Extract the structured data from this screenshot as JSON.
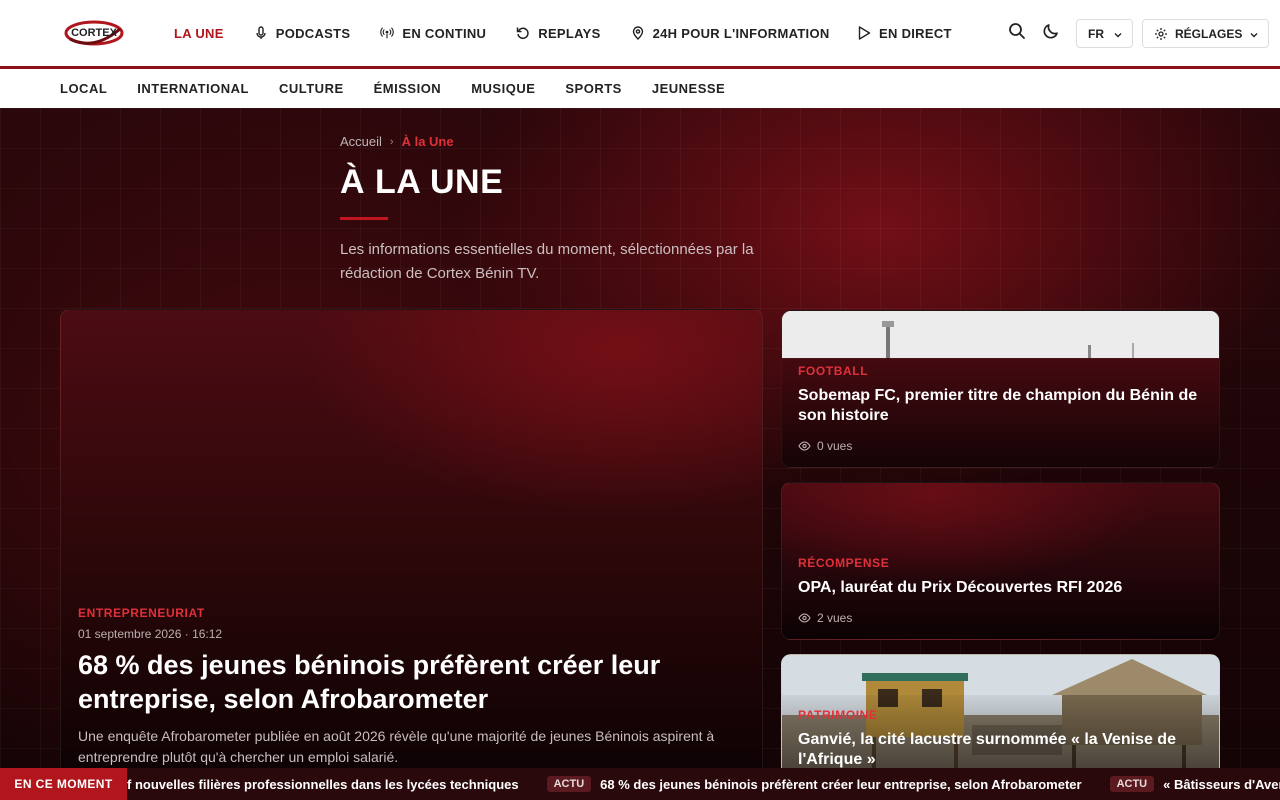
{
  "logo": {
    "text": "CORTEX"
  },
  "nav": {
    "items": [
      {
        "label": "LA UNE",
        "icon": "none"
      },
      {
        "label": "PODCASTS",
        "icon": "microphone-icon"
      },
      {
        "label": "EN CONTINU",
        "icon": "broadcast-icon"
      },
      {
        "label": "REPLAYS",
        "icon": "replay-icon"
      },
      {
        "label": "24H POUR L'INFORMATION",
        "icon": "location-pin-icon"
      }
    ],
    "live_label": "EN DIRECT",
    "language": "FR",
    "settings_label": "RÉGLAGES"
  },
  "subnav": {
    "items": [
      "LOCAL",
      "INTERNATIONAL",
      "CULTURE",
      "ÉMISSION",
      "MUSIQUE",
      "SPORTS",
      "JEUNESSE"
    ]
  },
  "breadcrumb": {
    "home": "Accueil",
    "current": "À la Une"
  },
  "page": {
    "title": "À LA UNE",
    "description": "Les informations essentielles du moment, sélectionnées par la rédaction de Cortex Bénin TV."
  },
  "featured": {
    "category": "ENTREPRENEURIAT",
    "date": "01 septembre 2026 · 16:12",
    "headline": "68 % des jeunes béninois préfèrent créer leur entreprise, selon Afrobarometer",
    "excerpt": "Une enquête Afrobarometer publiée en août 2026 révèle qu'une majorité de jeunes Béninois aspirent à entreprendre plutôt qu'à chercher un emploi salarié."
  },
  "side_articles": [
    {
      "category": "FOOTBALL",
      "title": "Sobemap FC, premier titre de champion du Bénin de son histoire",
      "views": "0 vues"
    },
    {
      "category": "RÉCOMPENSE",
      "title": "OPA, lauréat du Prix Découvertes RFI 2026",
      "views": "2 vues"
    },
    {
      "category": "PATRIMOINE",
      "title": "Ganvié, la cité lacustre surnommée « la Venise de l'Afrique »"
    }
  ],
  "ticker": {
    "label": "EN CE MOMENT",
    "items": [
      {
        "tag": "",
        "text": "f nouvelles filières professionnelles dans les lycées techniques"
      },
      {
        "tag": "ACTU",
        "text": "68 % des jeunes béninois préfèrent créer leur entreprise, selon Afrobarometer"
      },
      {
        "tag": "ACTU",
        "text": "« Bâtisseurs d'Avenir » : vingt je"
      }
    ]
  },
  "colors": {
    "accent": "#b0161c",
    "accent_text": "#e0313a",
    "dark_bg": "#1a0507"
  }
}
